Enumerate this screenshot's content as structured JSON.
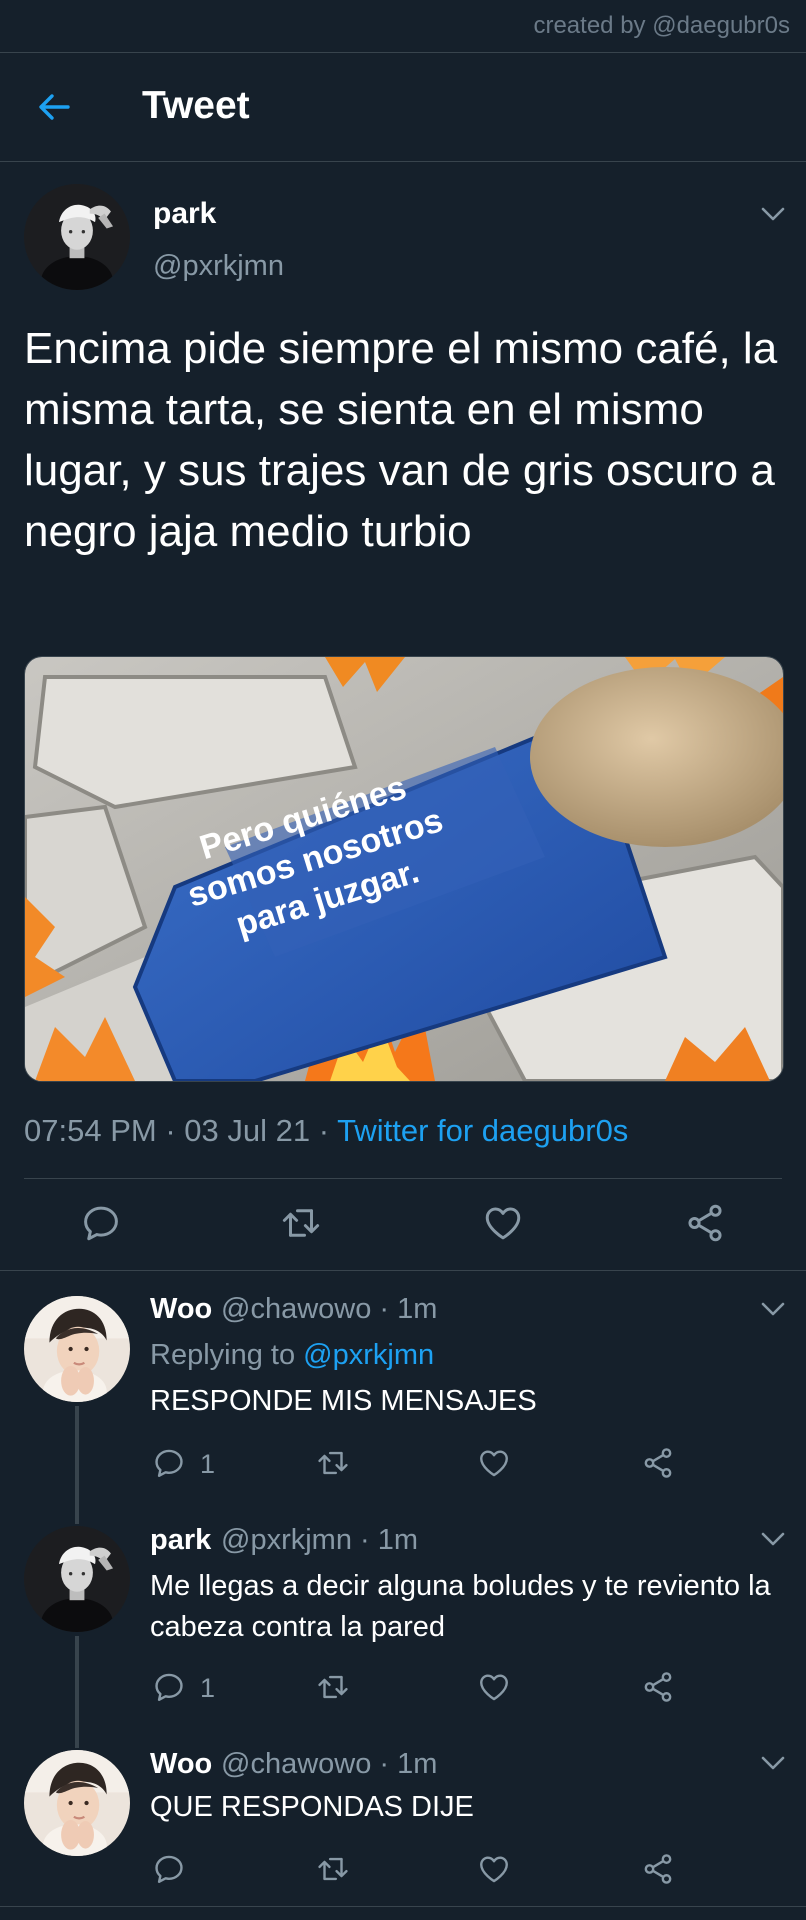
{
  "credit": "created by @daegubr0s",
  "header": {
    "title": "Tweet"
  },
  "main_tweet": {
    "author": {
      "name": "park",
      "handle": "@pxrkjmn"
    },
    "text": "Encima pide siempre el mismo café, la misma tarta, se sienta en el mismo lugar, y sus trajes van de gris oscuro a negro jaja medio turbio",
    "image_caption": [
      "Pero quiénes",
      "somos nosotros",
      "para juzgar."
    ],
    "time": "07:54 PM",
    "date": "03 Jul 21",
    "source": "Twitter for daegubr0s"
  },
  "replies": [
    {
      "name": "Woo",
      "handle": "@chawowo",
      "time": "1m",
      "replying_prefix": "Replying to ",
      "replying_to": "@pxrkjmn",
      "text": "RESPONDE MIS MENSAJES",
      "reply_count": "1"
    },
    {
      "name": "park",
      "handle": "@pxrkjmn",
      "time": "1m",
      "text": "Me llegas a decir alguna boludes y te reviento la cabeza contra la pared",
      "reply_count": "1"
    },
    {
      "name": "Woo",
      "handle": "@chawowo",
      "time": "1m",
      "text": "QUE RESPONDAS DIJE"
    }
  ],
  "icons": {
    "back": "arrow-left-icon",
    "reply": "speech-bubble-icon",
    "retweet": "retweet-icon",
    "like": "heart-icon",
    "share": "share-icon",
    "more": "chevron-down-icon"
  },
  "colors": {
    "background": "#15202b",
    "accent": "#1da1f2",
    "secondary_text": "#8899a6",
    "divider": "#38444d"
  }
}
